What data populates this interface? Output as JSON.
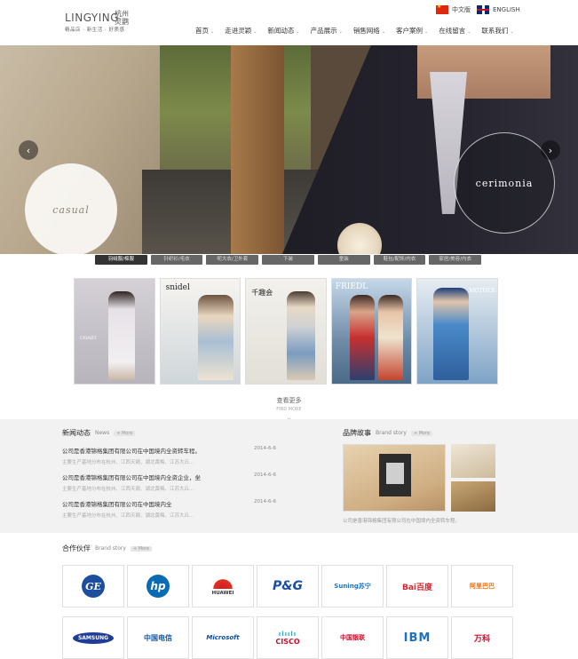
{
  "header": {
    "logo_en": "LINGYING",
    "logo_cn": "杭州灵鹦",
    "logo_tagline": "精品店 · 新生活 · 好质感",
    "lang_cn": "中文版",
    "lang_en": "ENGLISH"
  },
  "nav": [
    {
      "label": "首页"
    },
    {
      "label": "走进灵颖"
    },
    {
      "label": "新闻动态"
    },
    {
      "label": "产品展示"
    },
    {
      "label": "销售网络"
    },
    {
      "label": "客户案例"
    },
    {
      "label": "在线留言"
    },
    {
      "label": "联系我们"
    }
  ],
  "banner": {
    "left_label": "casual",
    "right_label": "cerimonia",
    "prev": "‹",
    "next": "›",
    "active_slide": 1,
    "slide_count": 3
  },
  "tabs": [
    {
      "label": "羽绒服/棉服",
      "active": true
    },
    {
      "label": "针织衫/毛衣",
      "active": false
    },
    {
      "label": "呢大衣/卫外套",
      "active": false
    },
    {
      "label": "下装",
      "active": false
    },
    {
      "label": "童装",
      "active": false
    },
    {
      "label": "鞋包/配饰/内衣",
      "active": false
    },
    {
      "label": "家居/美容/内衣",
      "active": false
    }
  ],
  "products": [
    {
      "label": "CHART"
    },
    {
      "label": "snidel"
    },
    {
      "label": "千趣会"
    },
    {
      "label": "FRIEDL"
    },
    {
      "label": "MOTHER"
    }
  ],
  "more": {
    "label": "查看更多",
    "sub": "FIND MORE"
  },
  "news": {
    "title": "新闻动态",
    "title_en": "News",
    "more": "+ More",
    "items": [
      {
        "title": "公司是香港锦格集团有限公司在中国境内全资转车程。",
        "date": "2014-6-6",
        "summary": "主要生产基地分布在杭州、江西天赣、湖北黄梅、江苏大丘..."
      },
      {
        "title": "公司是香港锦格集团有限公司在中国境内全资企业，坐",
        "date": "2014-6-6",
        "summary": "主要生产基地分布在杭州、江西天赣、湖北黄梅、江苏大丘..."
      },
      {
        "title": "公司是香港锦格集团有限公司在中国境内全",
        "date": "2014-6-6",
        "summary": "主要生产基地分布在杭州、江西天赣、湖北黄梅、江苏大丘..."
      }
    ]
  },
  "brand": {
    "title": "品牌故事",
    "title_en": "Brand story",
    "more": "+ More",
    "caption": "公司是香港锦格集团有限公司在中国境内全资转车程。"
  },
  "partners": {
    "title": "合作伙伴",
    "title_en": "Brand story",
    "more": "+ More",
    "logos": [
      {
        "name": "GE",
        "text": "GE",
        "icon": "ge-logo-icon"
      },
      {
        "name": "hp",
        "text": "hp",
        "icon": "hp-logo-icon"
      },
      {
        "name": "HUAWEI",
        "text": "HUAWEI",
        "icon": "huawei-logo-icon"
      },
      {
        "name": "P&G",
        "text": "P&G",
        "icon": "pg-logo-icon"
      },
      {
        "name": "Suning",
        "text": "Suning苏宁",
        "icon": "suning-logo-icon"
      },
      {
        "name": "Baidu",
        "text": "Bai百度",
        "icon": "baidu-logo-icon"
      },
      {
        "name": "Alibaba",
        "text": "阿里巴巴",
        "icon": "alibaba-logo-icon"
      },
      {
        "name": "Samsung",
        "text": "SAMSUNG",
        "icon": "samsung-logo-icon"
      },
      {
        "name": "China Telecom",
        "text": "中国电信",
        "icon": "chinatelecom-logo-icon"
      },
      {
        "name": "Microsoft",
        "text": "Microsoft",
        "icon": "microsoft-logo-icon"
      },
      {
        "name": "Cisco",
        "text": "CISCO",
        "icon": "cisco-logo-icon"
      },
      {
        "name": "UnionPay",
        "text": "中国银联",
        "icon": "unionpay-logo-icon"
      },
      {
        "name": "IBM",
        "text": "IBM",
        "icon": "ibm-logo-icon"
      },
      {
        "name": "Vanke",
        "text": "万科",
        "icon": "vanke-logo-icon"
      }
    ]
  },
  "colors": {
    "accent_orange": "#e07a2b",
    "tab_dark": "#333333",
    "section_bg": "#f2f2f2"
  }
}
